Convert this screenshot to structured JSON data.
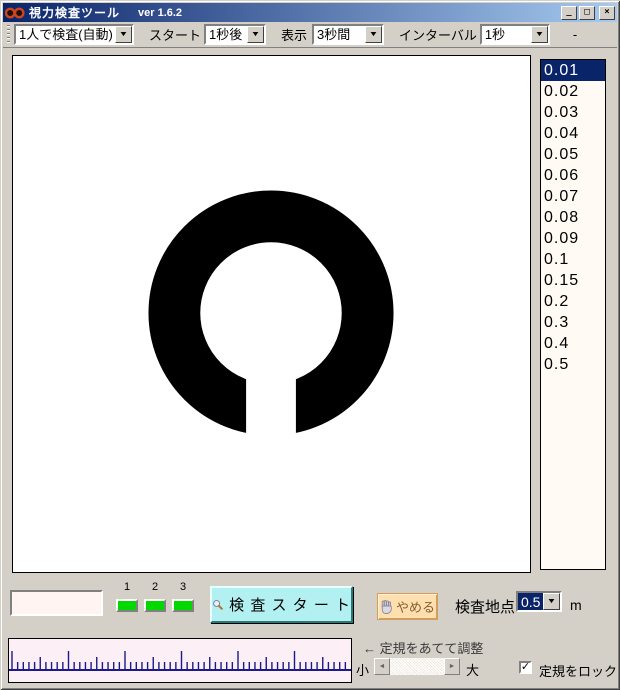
{
  "window": {
    "title": "視力検査ツール",
    "version": "ver 1.6.2",
    "buttons": {
      "minimize": "_",
      "maximize": "□",
      "close": "×"
    }
  },
  "icons": {
    "dropdown_arrow": "▼",
    "scroll_left": "◄",
    "scroll_right": "►",
    "check": "✓"
  },
  "toolbar": {
    "mode_select": "1人で検査(自動)",
    "start_label": "スタート",
    "start_select": "1秒後",
    "display_label": "表示",
    "display_select": "3秒間",
    "interval_label": "インターバル",
    "interval_select": "1秒",
    "status": "-"
  },
  "acuity_list": {
    "items": [
      "0.01",
      "0.02",
      "0.03",
      "0.04",
      "0.05",
      "0.06",
      "0.07",
      "0.08",
      "0.09",
      "0.1",
      "0.15",
      "0.2",
      "0.3",
      "0.4",
      "0.5"
    ],
    "selected": "0.01",
    "selected_index": 0
  },
  "optotype": {
    "name": "landolt-c",
    "gap_direction": "down"
  },
  "bottom": {
    "answer_field": {
      "value": "",
      "placeholder": ""
    },
    "indicators": [
      {
        "label": "1"
      },
      {
        "label": "2"
      },
      {
        "label": "3"
      }
    ],
    "start_button": "検 査 ス タ ー ト",
    "stop_button": "やめる",
    "distance_label": "検査地点",
    "distance_value": "0.5",
    "unit_label": "m"
  },
  "ruler_panel": {
    "hint": "← 定規をあてて調整",
    "small_label": "小",
    "large_label": "大",
    "lock_label": "定規をロック",
    "lock_checked": true
  },
  "colors": {
    "window_bg": "#d4d0c8",
    "title_grad_start": "#0a246a",
    "title_grad_end": "#a6caf0",
    "accent": "#0a246a",
    "canvas_bg": "#ffffff",
    "list_bg": "#fffaf3",
    "field_bg": "#fff4f2",
    "start_btn_bg": "#b2f0f2",
    "stop_btn_bg": "#ffdfae",
    "stop_btn_border": "#d79b55",
    "led_green": "#00d800",
    "ruler_bg": "#fceff5",
    "tick_color": "#1a1a8a",
    "icon_orange": "#cc4422"
  }
}
